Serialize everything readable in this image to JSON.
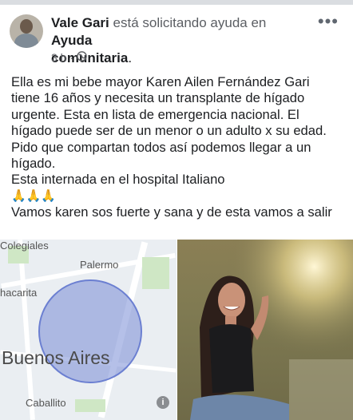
{
  "post": {
    "author": "Vale Gari",
    "action": "está solicitando ayuda en",
    "group_line1": "Ayuda",
    "group_line2": "comunitaria",
    "period": ".",
    "time": "3 h",
    "dot": "·",
    "more_icon": "•••",
    "text_lines": [
      "Ella es mi bebe mayor Karen Ailen Fernández Gari",
      "tiene 16 años y necesita un transplante de hígado",
      "urgente. Esta en lista de emergencia nacional. El",
      "hígado puede ser de un menor o un adulto x su edad.",
      "Pido que compartan todos así podemos llegar a un",
      "hígado.",
      "Esta internada en el hospital Italiano"
    ],
    "emoji": "🙏🙏🙏",
    "closing": "Vamos karen sos fuerte y sana y de esta vamos a salir"
  },
  "map": {
    "labels": {
      "top": "Colegiales",
      "palermo": "Palermo",
      "chacarita": "hacarita",
      "city": "Buenos Aires",
      "caballito": "Caballito"
    },
    "info_icon": "i"
  },
  "icons": {
    "globe": "globe-icon",
    "more": "more-options-icon"
  }
}
